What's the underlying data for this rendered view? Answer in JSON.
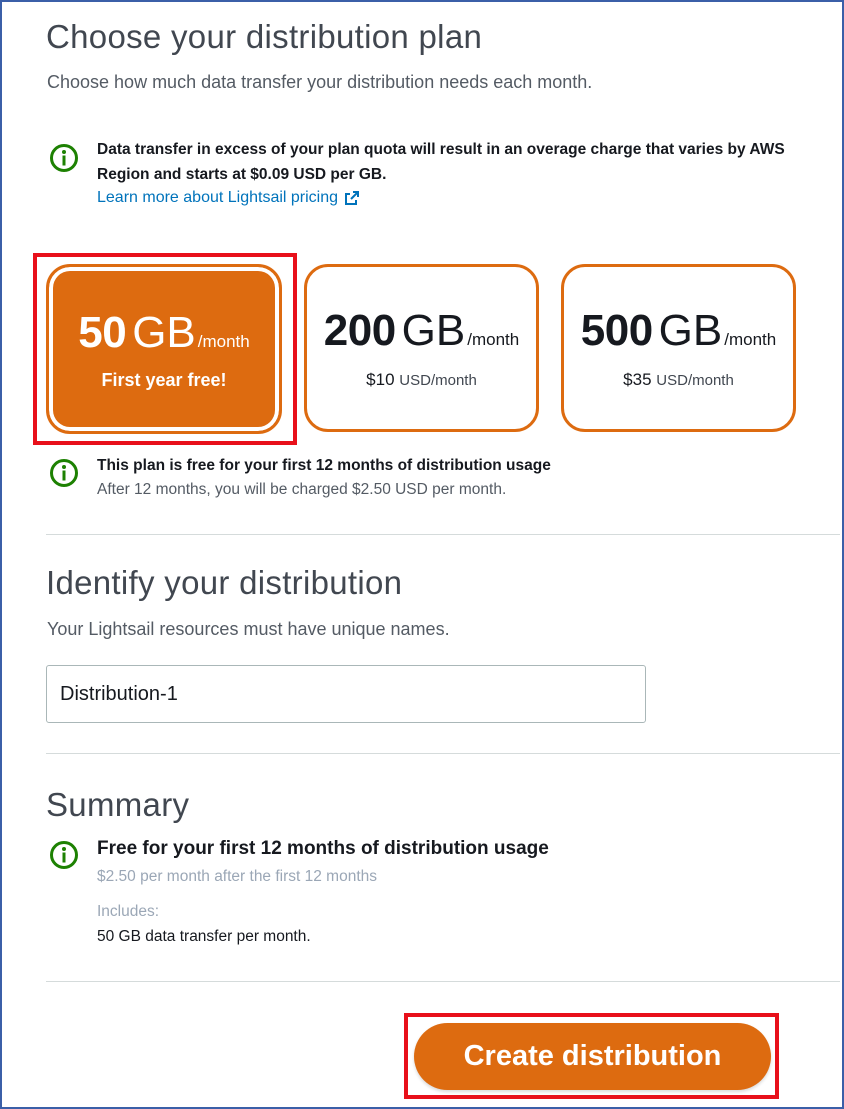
{
  "plan_section": {
    "title": "Choose your distribution plan",
    "subtitle": "Choose how much data transfer your distribution needs each month.",
    "overage_notice": "Data transfer in excess of your plan quota will result in an overage charge that varies by AWS Region and starts at $0.09 USD per GB.",
    "pricing_link": "Learn more about Lightsail pricing",
    "plans": [
      {
        "amount": "50",
        "unit": "GB",
        "period": "/month",
        "tagline": "First year free!",
        "selected": true
      },
      {
        "amount": "200",
        "unit": "GB",
        "period": "/month",
        "price": "$10",
        "price_unit": "USD/month",
        "selected": false
      },
      {
        "amount": "500",
        "unit": "GB",
        "period": "/month",
        "price": "$35",
        "price_unit": "USD/month",
        "selected": false
      }
    ],
    "free_notice_title": "This plan is free for your first 12 months of distribution usage",
    "free_notice_detail": "After 12 months, you will be charged $2.50 USD per month."
  },
  "identify_section": {
    "title": "Identify your distribution",
    "subtitle": "Your Lightsail resources must have unique names.",
    "name_value": "Distribution-1"
  },
  "summary_section": {
    "title": "Summary",
    "headline": "Free for your first 12 months of distribution usage",
    "after_price": "$2.50 per month after the first 12 months",
    "includes_label": "Includes:",
    "includes_detail": "50 GB data transfer per month."
  },
  "actions": {
    "create_label": "Create distribution"
  },
  "colors": {
    "accent": "#dd6b10",
    "link": "#0073bb",
    "success": "#1d8102",
    "highlight": "#e8101a"
  },
  "icons": [
    "info-icon",
    "external-link-icon"
  ]
}
